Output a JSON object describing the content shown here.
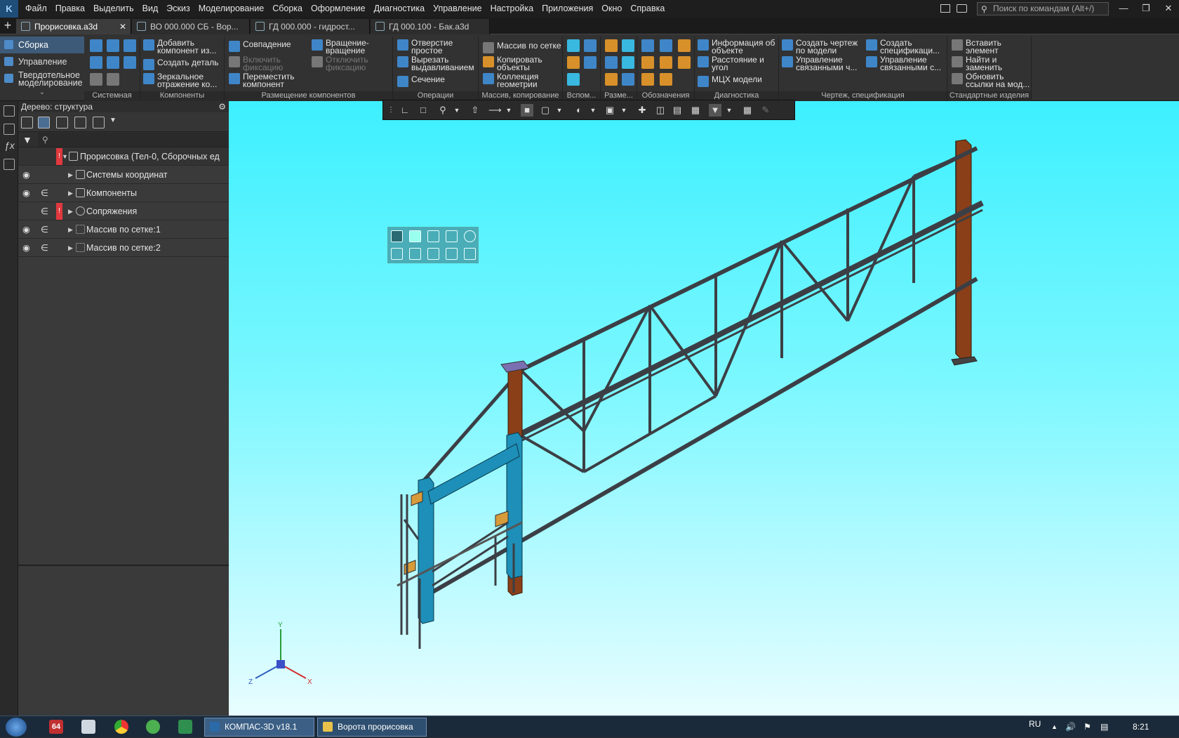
{
  "app": {
    "logo": "K"
  },
  "menu": [
    "Файл",
    "Правка",
    "Выделить",
    "Вид",
    "Эскиз",
    "Моделирование",
    "Сборка",
    "Оформление",
    "Диагностика",
    "Управление",
    "Настройка",
    "Приложения",
    "Окно",
    "Справка"
  ],
  "search": {
    "placeholder": "Поиск по командам (Alt+/)"
  },
  "tabs": [
    {
      "label": "Прорисовка.a3d",
      "active": true
    },
    {
      "label": "ВО 000.000 СБ - Вор..."
    },
    {
      "label": "ГД 000.000 - гидрост..."
    },
    {
      "label": "ГД 000.100 - Бак.a3d"
    }
  ],
  "modes": [
    "Сборка",
    "Управление",
    "Твердотельное моделирование"
  ],
  "ribbon": {
    "groups": {
      "system": "Системная",
      "components": "Компоненты",
      "placement": "Размещение компонентов",
      "operations": "Операции",
      "array": "Массив, копирование",
      "aux": "Вспом...",
      "sizes": "Разме...",
      "notation": "Обозначения",
      "diagnostics": "Диагностика",
      "drawing": "Чертеж, спецификация",
      "standard": "Стандартные изделия"
    },
    "buttons": {
      "add_component": "Добавить компонент из...",
      "create_part": "Создать деталь",
      "mirror": "Зеркальное отражение ко...",
      "coincidence": "Совпадение",
      "fix_on": "Включить фиксацию",
      "move_component": "Переместить компонент",
      "rotate": "Вращение-вращение",
      "fix_off": "Отключить фиксацию",
      "simple_hole": "Отверстие простое",
      "cut_extrude": "Вырезать выдавливанием",
      "section": "Сечение",
      "grid_array": "Массив по сетке",
      "copy_objects": "Копировать объекты",
      "geometry_collection": "Коллекция геометрии",
      "object_info": "Информация об объекте",
      "distance_angle": "Расстояние и угол",
      "mcx": "МЦХ модели",
      "create_drawing": "Создать чертеж по модели",
      "manage_linked_1": "Управление связанными ч...",
      "create_spec": "Создать спецификаци...",
      "manage_linked_2": "Управление связанными с...",
      "insert_element": "Вставить элемент",
      "find_replace": "Найти и заменить",
      "update_links": "Обновить ссылки на мод..."
    }
  },
  "tree": {
    "header": "Дерево: структура",
    "root": "Прорисовка (Тел-0, Сборочных ед",
    "rows": [
      {
        "label": "Системы координат",
        "eye": true,
        "include": false,
        "error": false
      },
      {
        "label": "Компоненты",
        "eye": true,
        "include": true,
        "error": false
      },
      {
        "label": "Сопряжения",
        "eye": false,
        "include": true,
        "error": true
      },
      {
        "label": "Массив по сетке:1",
        "eye": true,
        "include": true,
        "error": false
      },
      {
        "label": "Массив по сетке:2",
        "eye": true,
        "include": true,
        "error": false
      }
    ]
  },
  "axes": {
    "x": "X",
    "y": "Y",
    "z": "Z"
  },
  "taskbar": {
    "tasks": [
      "КОМПАС-3D v18.1",
      "Ворота прорисовка"
    ],
    "badge": "64",
    "lang": "RU",
    "time": "8:21"
  },
  "colors": {
    "viewport_top": "#3df0ff",
    "viewport_bottom": "#e8fdff",
    "frame": "#3a3f45",
    "post": "#7a3a1a",
    "blue_frame": "#1e8fb8"
  }
}
